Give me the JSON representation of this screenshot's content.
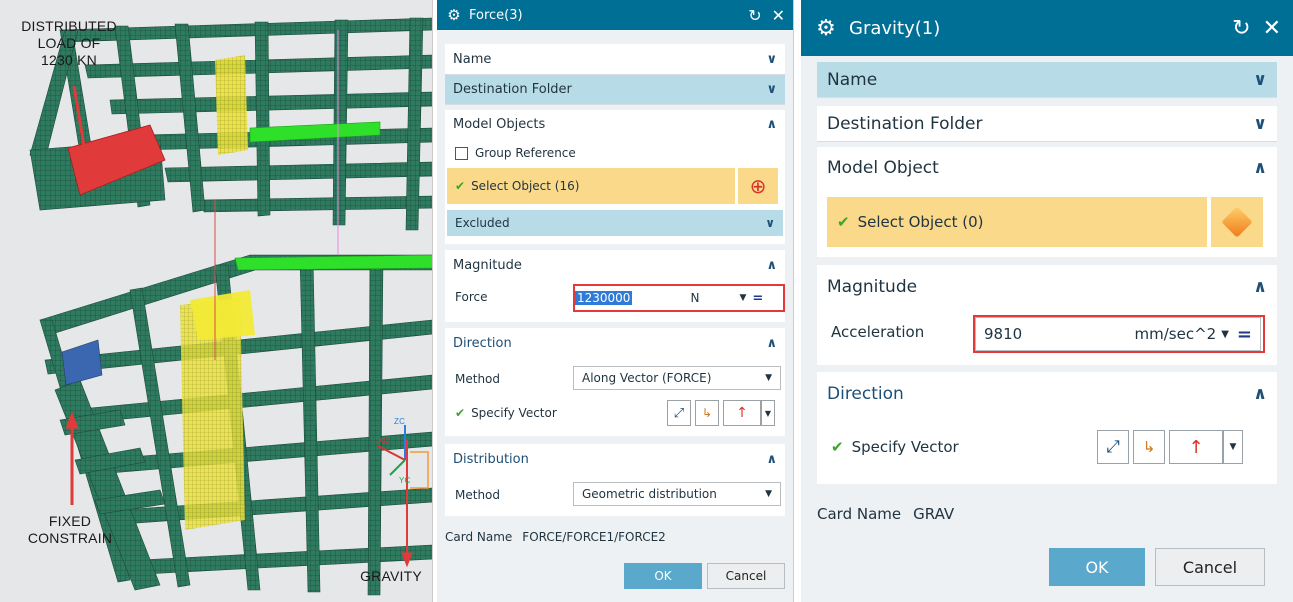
{
  "viewport": {
    "label_load": [
      "DISTRIBUTED",
      "LOAD OF",
      "1230 KN"
    ],
    "label_fixed": [
      "FIXED",
      "CONSTRAIN"
    ],
    "label_gravity": "GRAVITY",
    "axis_zc": "ZC",
    "axis_xc": "XC",
    "axis_yc": "YC"
  },
  "force_dialog": {
    "title": "Force(3)",
    "sections": {
      "name": "Name",
      "destination": "Destination Folder",
      "model_objects": "Model Objects",
      "magnitude": "Magnitude",
      "direction": "Direction",
      "distribution": "Distribution"
    },
    "group_reference": "Group Reference",
    "select_object": "Select Object (16)",
    "excluded": "Excluded",
    "force_label": "Force",
    "force_value": "1230000",
    "force_unit": "N",
    "direction_method_label": "Method",
    "direction_method_value": "Along Vector (FORCE)",
    "specify_vector": "Specify Vector",
    "distribution_method_label": "Method",
    "distribution_method_value": "Geometric distribution",
    "card_name_label": "Card Name",
    "card_name_value": "FORCE/FORCE1/FORCE2",
    "ok": "OK",
    "cancel": "Cancel"
  },
  "gravity_dialog": {
    "title": "Gravity(1)",
    "sections": {
      "name": "Name",
      "destination": "Destination Folder",
      "model_object": "Model Object",
      "magnitude": "Magnitude",
      "direction": "Direction"
    },
    "select_object": "Select Object (0)",
    "acceleration_label": "Acceleration",
    "acceleration_value": "9810",
    "acceleration_unit": "mm/sec^2",
    "specify_vector": "Specify Vector",
    "card_name_label": "Card Name",
    "card_name_value": "GRAV",
    "ok": "OK",
    "cancel": "Cancel"
  },
  "icons": {
    "gear": "gear-icon",
    "reset": "reset-icon",
    "close": "close-icon",
    "chevron_down": "chevron-down-icon",
    "chevron_up": "chevron-up-icon",
    "check": "check-icon",
    "crosshair": "crosshair-icon",
    "cube": "cube-icon",
    "equals": "equals-icon"
  },
  "colors": {
    "title_bar": "#006f96",
    "section_highlight": "#b8dce7",
    "selection": "#fbd98a",
    "ok_button": "#5aa9cc",
    "mesh": "#2e7a60",
    "load_arrow": "#e03a3a",
    "highlight_red": "#e23a3a"
  }
}
